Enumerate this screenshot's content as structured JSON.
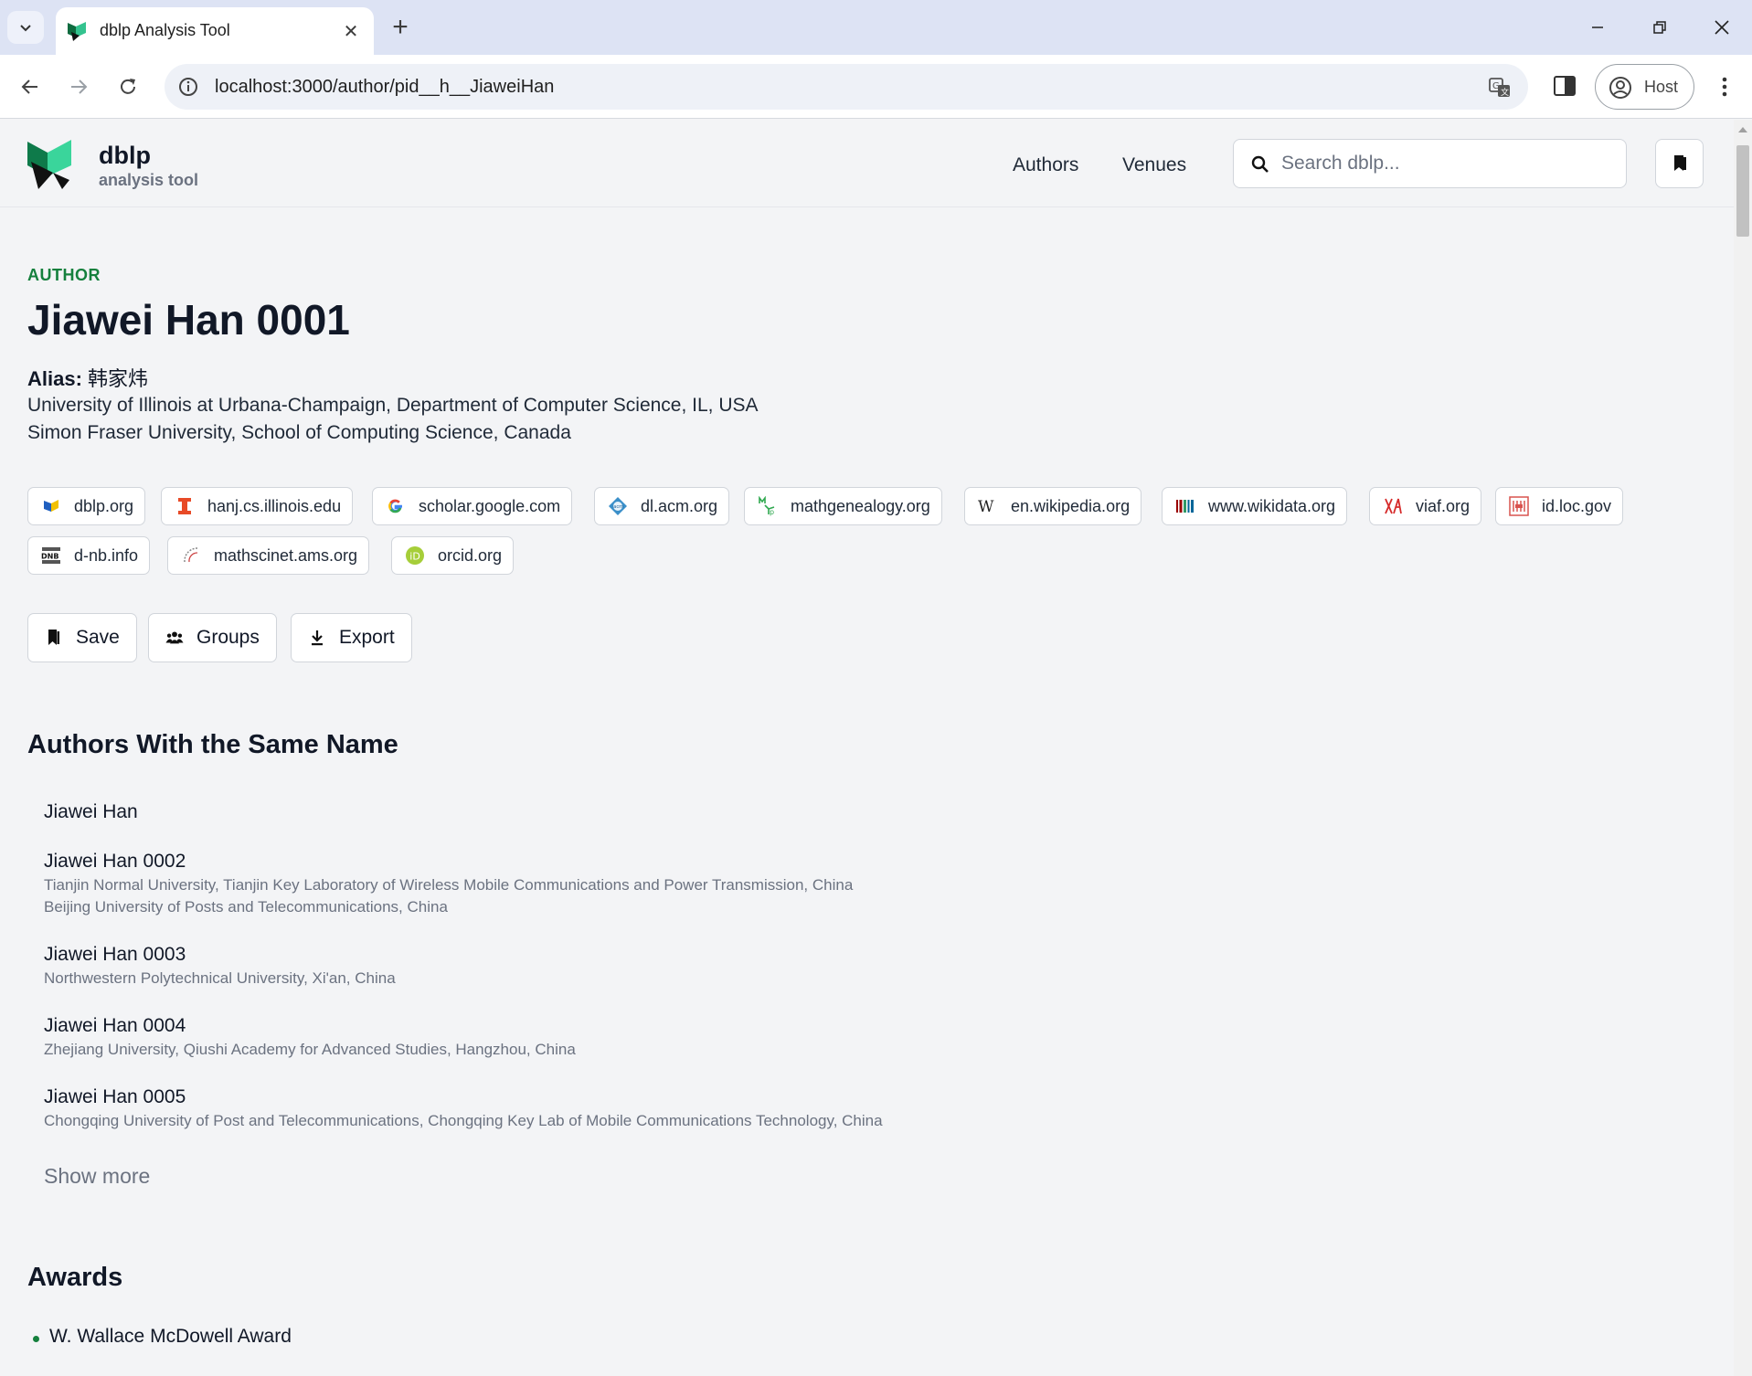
{
  "browser": {
    "tab_title": "dblp Analysis Tool",
    "url": "localhost:3000/author/pid__h__JiaweiHan",
    "profile_label": "Host"
  },
  "header": {
    "logo_name": "dblp",
    "logo_sub": "analysis tool",
    "nav": [
      "Authors",
      "Venues"
    ],
    "search_placeholder": "Search dblp..."
  },
  "author": {
    "eyebrow": "AUTHOR",
    "name": "Jiawei Han 0001",
    "alias_label": "Alias:",
    "alias_value": "韩家炜",
    "affiliations": [
      "University of Illinois at Urbana-Champaign, Department of Computer Science, IL, USA",
      "Simon Fraser University, School of Computing Science, Canada"
    ]
  },
  "links": [
    {
      "label": "dblp.org",
      "icon": "dblp-icon"
    },
    {
      "label": "hanj.cs.illinois.edu",
      "icon": "illinois-icon"
    },
    {
      "label": "scholar.google.com",
      "icon": "google-icon"
    },
    {
      "label": "dl.acm.org",
      "icon": "acm-icon"
    },
    {
      "label": "mathgenealogy.org",
      "icon": "mathgenealogy-icon"
    },
    {
      "label": "en.wikipedia.org",
      "icon": "wikipedia-icon"
    },
    {
      "label": "www.wikidata.org",
      "icon": "wikidata-icon"
    },
    {
      "label": "viaf.org",
      "icon": "viaf-icon"
    },
    {
      "label": "id.loc.gov",
      "icon": "loc-icon"
    },
    {
      "label": "d-nb.info",
      "icon": "dnb-icon"
    },
    {
      "label": "mathscinet.ams.org",
      "icon": "mathscinet-icon"
    },
    {
      "label": "orcid.org",
      "icon": "orcid-icon"
    }
  ],
  "actions": {
    "save": "Save",
    "groups": "Groups",
    "export": "Export"
  },
  "same_name": {
    "title": "Authors With the Same Name",
    "items": [
      {
        "name": "Jiawei Han",
        "affiliations": []
      },
      {
        "name": "Jiawei Han 0002",
        "affiliations": [
          "Tianjin Normal University, Tianjin Key Laboratory of Wireless Mobile Communications and Power Transmission, China",
          "Beijing University of Posts and Telecommunications, China"
        ]
      },
      {
        "name": "Jiawei Han 0003",
        "affiliations": [
          "Northwestern Polytechnical University, Xi'an, China"
        ]
      },
      {
        "name": "Jiawei Han 0004",
        "affiliations": [
          "Zhejiang University, Qiushi Academy for Advanced Studies, Hangzhou, China"
        ]
      },
      {
        "name": "Jiawei Han 0005",
        "affiliations": [
          "Chongqing University of Post and Telecommunications, Chongqing Key Lab of Mobile Communications Technology, China"
        ]
      }
    ],
    "show_more": "Show more"
  },
  "awards": {
    "title": "Awards",
    "items": [
      "W. Wallace McDowell Award"
    ]
  },
  "colors": {
    "accent_green": "#15803d",
    "page_bg": "#f3f4f6",
    "tabbar_bg": "#dde3f4"
  }
}
